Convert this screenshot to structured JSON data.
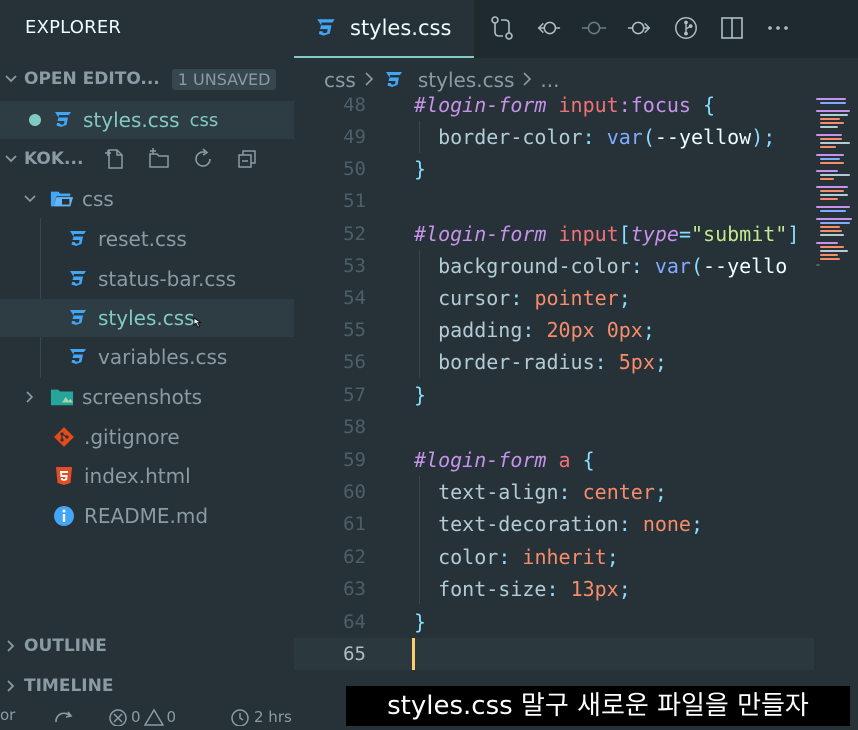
{
  "sidebar": {
    "title": "EXPLORER",
    "open_editors": {
      "label": "OPEN EDITO...",
      "badge": "1 UNSAVED"
    },
    "open_files": [
      {
        "name": "styles.css",
        "folder": "css"
      }
    ],
    "project": {
      "label": "KOK..."
    },
    "tree": [
      {
        "name": "css",
        "type": "folder"
      },
      {
        "name": "reset.css",
        "type": "css"
      },
      {
        "name": "status-bar.css",
        "type": "css"
      },
      {
        "name": "styles.css",
        "type": "css"
      },
      {
        "name": "variables.css",
        "type": "css"
      },
      {
        "name": "screenshots",
        "type": "folder"
      },
      {
        "name": ".gitignore",
        "type": "git"
      },
      {
        "name": "index.html",
        "type": "html"
      },
      {
        "name": "README.md",
        "type": "info"
      }
    ],
    "outline": "OUTLINE",
    "timeline": "TIMELINE"
  },
  "tab": {
    "label": "styles.css"
  },
  "breadcrumb": {
    "folder": "css",
    "file": "styles.css",
    "more": "..."
  },
  "code": {
    "line_numbers": [
      "48",
      "49",
      "50",
      "51",
      "52",
      "53",
      "54",
      "55",
      "56",
      "57",
      "58",
      "59",
      "60",
      "61",
      "62",
      "63",
      "64",
      "65"
    ],
    "l48": {
      "id": "#login-form",
      "tag": "input",
      "pseudo": ":focus",
      "brace": "{"
    },
    "l49": {
      "prop": "border-color",
      "fn": "var",
      "arg": "--yellow",
      "end": ");"
    },
    "l52": {
      "id": "#login-form",
      "tag": "input",
      "attr": "type",
      "str": "\"submit\"",
      "bracket": "]"
    },
    "l53": {
      "prop": "background-color",
      "fn": "var",
      "arg": "--yello"
    },
    "l54": {
      "prop": "cursor",
      "val": "pointer"
    },
    "l55": {
      "prop": "padding",
      "val": "20px 0px"
    },
    "l56": {
      "prop": "border-radius",
      "val": "5px"
    },
    "l59": {
      "id": "#login-form",
      "tag": "a",
      "brace": "{"
    },
    "l60": {
      "prop": "text-align",
      "val": "center"
    },
    "l61": {
      "prop": "text-decoration",
      "val": "none"
    },
    "l62": {
      "prop": "color",
      "val": "inherit"
    },
    "l63": {
      "prop": "font-size",
      "val": "13px"
    },
    "close_brace": "}"
  },
  "status": {
    "left_partial": "or",
    "problems_errors": "0",
    "problems_warnings": "0",
    "time_partial": "2 hrs"
  },
  "subtitle": "styles.css 말구 새로운 파일을 만들자",
  "colors": {
    "accent": "#80cbc4",
    "css_icon": "#42a5f5",
    "cursor": "#ffcb6b"
  }
}
